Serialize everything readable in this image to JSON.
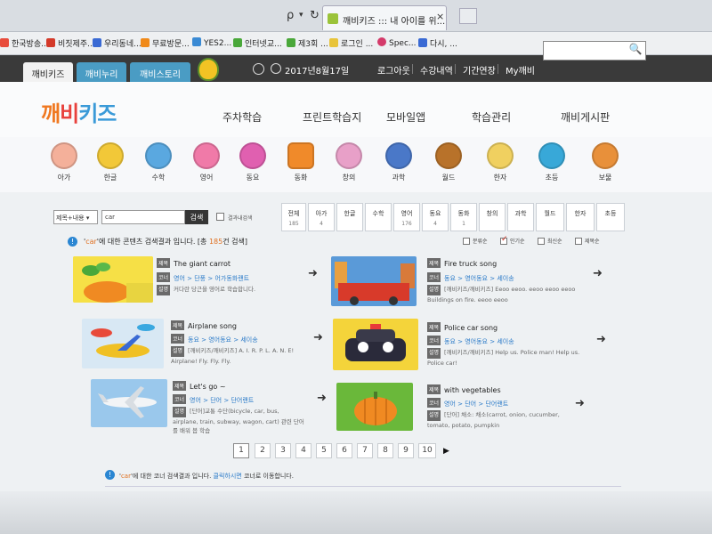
{
  "browser": {
    "nav_search": "ρ",
    "nav_dropdown": "▾",
    "nav_refresh": "↻",
    "tab_title": "깨비키즈 ::: 내 아이를 위...",
    "tab_close": "×",
    "favorites": [
      "한국방송...",
      "비짓제주...",
      "우리동네...",
      "무료방문...",
      "YES2...",
      "인터넷교...",
      "제3회 ...",
      "로그인 ...",
      "Spec...",
      "다시, ..."
    ]
  },
  "site": {
    "tabs": [
      "깨비키즈",
      "깨비누리",
      "깨비스토리"
    ],
    "date": "2017년8월17일",
    "links": [
      "로그아웃",
      "수강내역",
      "기간연장",
      "My깨비"
    ],
    "search_icon": "🔍"
  },
  "header": {
    "logo": [
      "깨",
      "비",
      "키즈"
    ],
    "menu": [
      "주차학습",
      "프린트학습지",
      "모바일앱",
      "학습관리",
      "깨비게시판"
    ]
  },
  "characters": [
    "아가",
    "한글",
    "수학",
    "영어",
    "동요",
    "동화",
    "창의",
    "과학",
    "월드",
    "한자",
    "초등",
    "보물"
  ],
  "search": {
    "select": "제목+내용 ▾",
    "query": "car",
    "button": "검색",
    "checkbox_label": "결과내검색"
  },
  "categories": [
    {
      "label": "전체",
      "count": "185"
    },
    {
      "label": "아가",
      "count": "4"
    },
    {
      "label": "한글",
      "count": ""
    },
    {
      "label": "수학",
      "count": ""
    },
    {
      "label": "영어",
      "count": "176"
    },
    {
      "label": "동요",
      "count": "4"
    },
    {
      "label": "동화",
      "count": "1"
    },
    {
      "label": "창의",
      "count": ""
    },
    {
      "label": "과학",
      "count": ""
    },
    {
      "label": "월드",
      "count": ""
    },
    {
      "label": "한자",
      "count": ""
    },
    {
      "label": "초등",
      "count": ""
    }
  ],
  "result_info": {
    "icon": "!",
    "pre": "'",
    "keyword": "car",
    "mid": "'에 대한 콘텐츠 검색결과 입니다. [총 ",
    "count": "185",
    "post": "건 검색]"
  },
  "sort_options": [
    {
      "label": "분류순",
      "checked": false
    },
    {
      "label": "인기순",
      "checked": true
    },
    {
      "label": "최신순",
      "checked": false
    },
    {
      "label": "제목순",
      "checked": false
    }
  ],
  "tags": {
    "title": "제목",
    "corner": "코너",
    "desc": "설명"
  },
  "results": [
    {
      "title": "The giant carrot",
      "path": "영어 > 단풍 > 어가동화랜트",
      "desc": "커다란 당근을 영어로 학습합니다."
    },
    {
      "title": "Fire truck song",
      "path": "동요 > 영어동요 > 세이송",
      "desc": "[깨비키즈/깨비키즈] Eeoo eeoo. eeoo eeoo eeoo Buildings on fire. eeoo eeoo"
    },
    {
      "title": "Airplane song",
      "path": "동요 > 영어동요 > 세이송",
      "desc": "[깨비키즈/깨비키즈] A. I. R. P. L. A. N. E! Airplane! Fly. Fly. Fly."
    },
    {
      "title": "Police car song",
      "path": "동요 > 영어동요 > 세이송",
      "desc": "[깨비키즈/깨비키즈] Help us. Police man! Help us. Police car!"
    },
    {
      "title": "Let's go ~",
      "path": "영어 > 단어 > 단어랜트",
      "desc": "[단어]교통 수단(bicycle, car, bus, airplane, train, subway, wagon, cart) 관련 단어를 배워 봅 학습"
    },
    {
      "title": "with vegetables",
      "path": "영어 > 단어 > 단어랜트",
      "desc": "[단어] 채소: 채소(carrot, onion, cucumber, tomato, potato, pumpkin"
    }
  ],
  "arrow": "➜",
  "pagination": {
    "pages": [
      "1",
      "2",
      "3",
      "4",
      "5",
      "6",
      "7",
      "8",
      "9",
      "10"
    ],
    "current": "1",
    "next": "▶"
  },
  "footer_info": {
    "icon": "!",
    "pre": "'",
    "keyword": "car",
    "mid": "'에 대한 코너 검색결과 입니다. ",
    "link": "클릭하시면",
    "post": " 코너로 이동합니다."
  }
}
